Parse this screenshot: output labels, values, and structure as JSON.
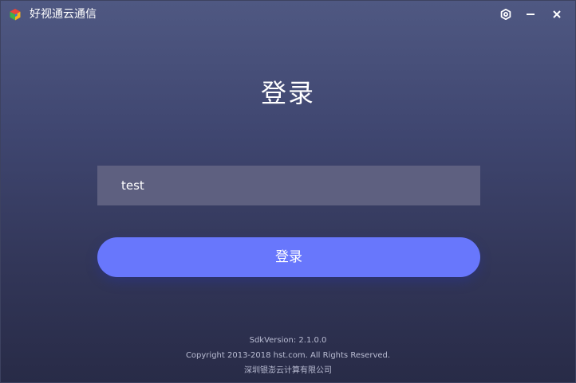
{
  "window": {
    "title": "好视通云通信",
    "logo_icon": "hst-cube-logo-icon",
    "controls": {
      "settings_icon": "gear-icon",
      "minimize_icon": "minimize-icon",
      "close_icon": "close-icon"
    }
  },
  "login": {
    "heading": "登录",
    "username": {
      "value": "test",
      "placeholder": ""
    },
    "button_label": "登录"
  },
  "footer": {
    "sdk_version": "SdkVersion:  2.1.0.0",
    "copyright": "Copyright 2013-2018 hst.com. All Rights Reserved.",
    "company": "深圳银澎云计算有限公司"
  },
  "colors": {
    "background_top": "#4f5882",
    "background_bottom": "#282b47",
    "input_background": "#5e6080",
    "accent_button": "#6877fc",
    "footer_text": "#b9bcd2"
  }
}
